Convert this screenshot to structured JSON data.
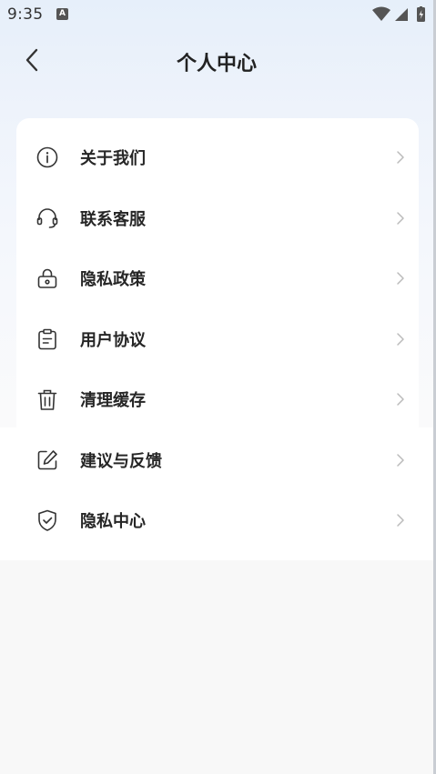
{
  "status_bar": {
    "time": "9:35",
    "notification_icon": "A"
  },
  "header": {
    "title": "个人中心",
    "back_icon": "chevron-left-icon"
  },
  "menu": {
    "items": [
      {
        "label": "关于我们",
        "icon": "info-icon"
      },
      {
        "label": "联系客服",
        "icon": "headset-icon"
      },
      {
        "label": "隐私政策",
        "icon": "lock-icon"
      },
      {
        "label": "用户协议",
        "icon": "clipboard-icon"
      },
      {
        "label": "清理缓存",
        "icon": "trash-icon"
      },
      {
        "label": "建议与反馈",
        "icon": "edit-icon"
      },
      {
        "label": "隐私中心",
        "icon": "shield-check-icon"
      }
    ]
  },
  "colors": {
    "text": "#262626",
    "icon": "#333333",
    "chevron": "#b8b8b8",
    "card": "#ffffff"
  }
}
